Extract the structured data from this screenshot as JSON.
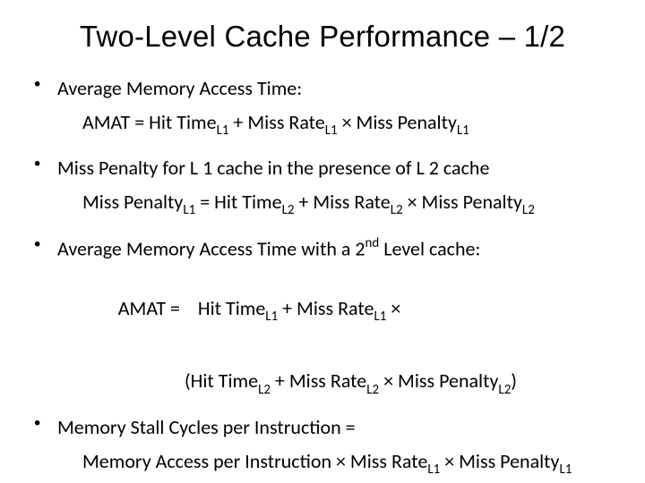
{
  "title": "Two-Level Cache Performance – 1/2",
  "bullets": [
    "Average Memory Access Time:",
    "Miss Penalty for L 1 cache in the presence of L 2 cache",
    "Average Memory Access Time with a 2",
    "Memory Stall Cycles per Instruction ="
  ],
  "bullet3_tail": " Level cache:",
  "bullet3_sup": "nd",
  "f1": {
    "p1": "AMAT = Hit Time",
    "s1": "L1",
    "p2": " + Miss Rate",
    "s2": "L1",
    "p3": " × Miss Penalty",
    "s3": "L1"
  },
  "f2": {
    "p1": "Miss Penalty",
    "s1": "L1",
    "p2": " = Hit Time",
    "s2": "L2",
    "p3": " + Miss Rate",
    "s3": "L2",
    "p4": " × Miss Penalty",
    "s4": "L2"
  },
  "f3a": {
    "p1": "AMAT =    Hit Time",
    "s1": "L1",
    "p2": " + Miss Rate",
    "s2": "L1",
    "p3": " ×"
  },
  "f3b": {
    "p1": "(Hit Time",
    "s1": "L2",
    "p2": " + Miss Rate",
    "s2": "L2",
    "p3": " × Miss Penalty",
    "s3": "L2",
    "p4": ")"
  },
  "f4": {
    "p1": "Memory Access per Instruction × Miss Rate",
    "s1": "L1",
    "p2": " × Miss Penalty",
    "s2": "L1"
  }
}
